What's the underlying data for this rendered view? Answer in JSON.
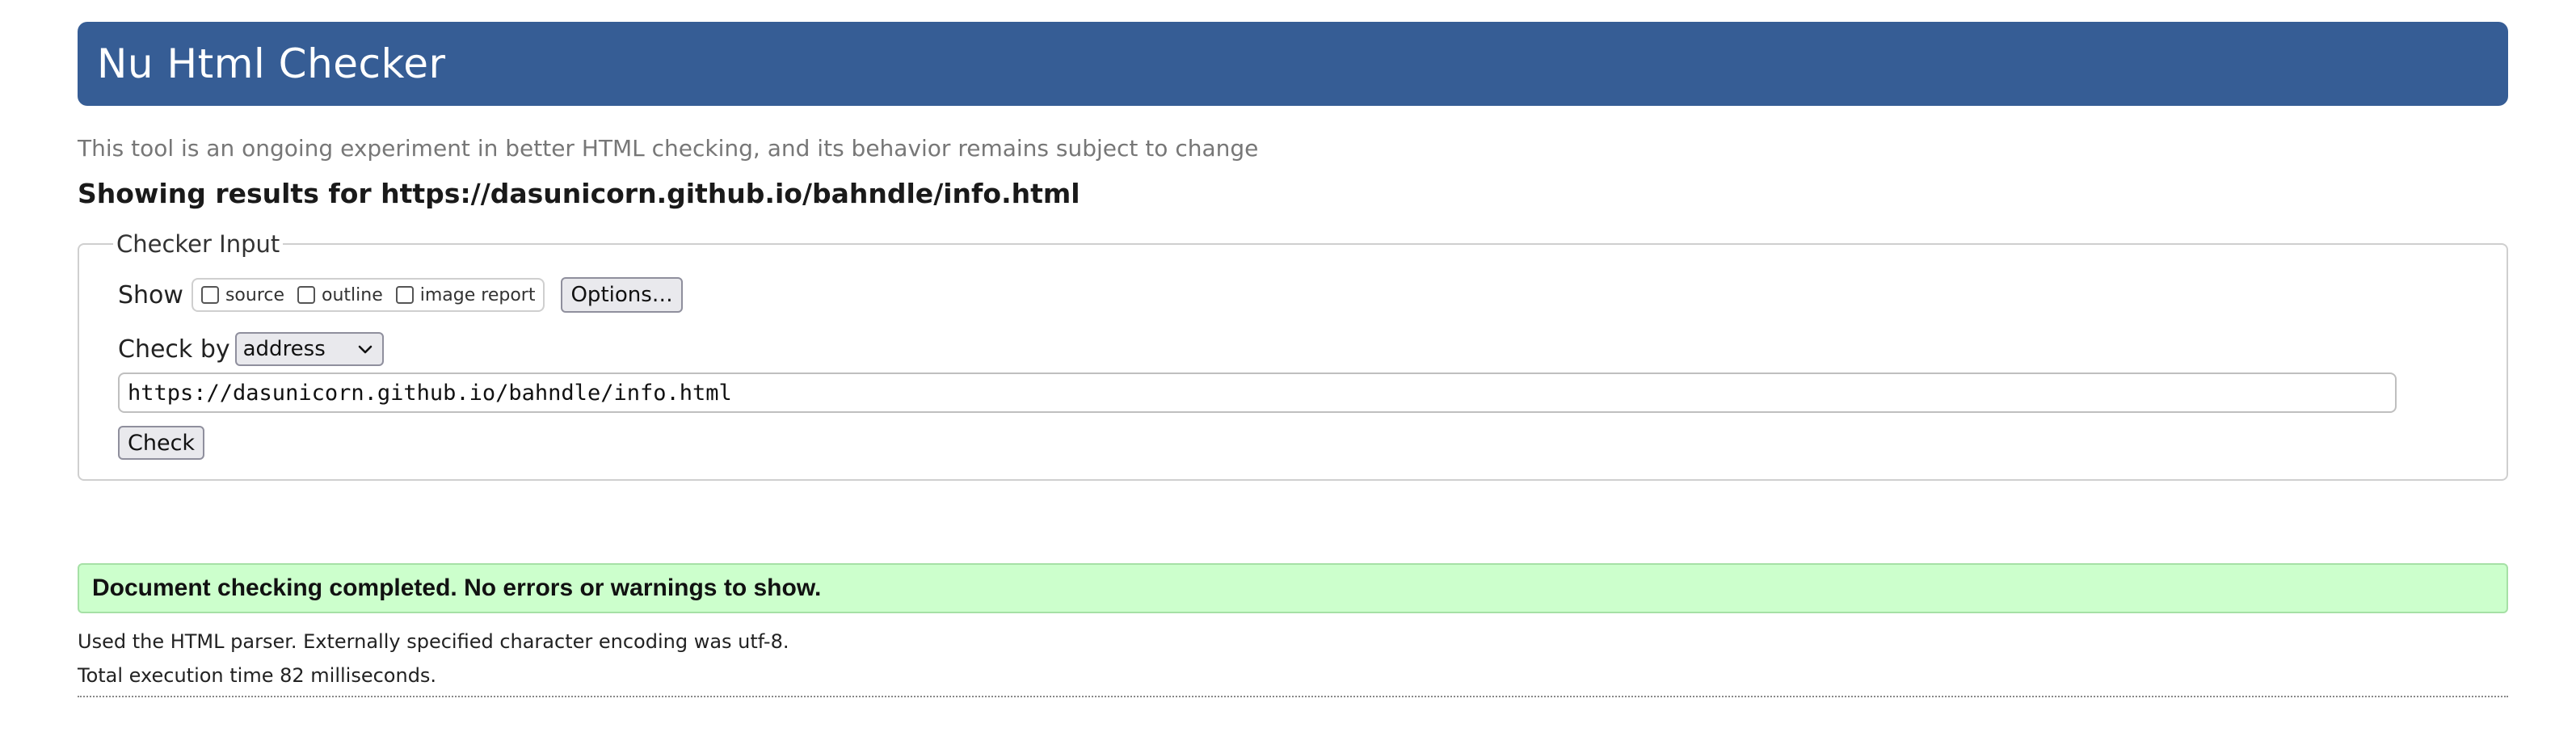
{
  "header": {
    "title": "Nu Html Checker"
  },
  "tagline": "This tool is an ongoing experiment in better HTML checking, and its behavior remains subject to change",
  "results_heading": "Showing results for https://dasunicorn.github.io/bahndle/info.html",
  "checker_input": {
    "legend": "Checker Input",
    "show_label": "Show",
    "show_options": [
      {
        "label": "source",
        "checked": false
      },
      {
        "label": "outline",
        "checked": false
      },
      {
        "label": "image report",
        "checked": false
      }
    ],
    "options_button": "Options…",
    "check_by_label": "Check by",
    "check_by_selected": "address",
    "url_value": "https://dasunicorn.github.io/bahndle/info.html",
    "check_button": "Check"
  },
  "result": {
    "success_message": "Document checking completed. No errors or warnings to show.",
    "parser_info": "Used the HTML parser. Externally specified character encoding was utf-8.",
    "execution_time": "Total execution time 82 milliseconds."
  },
  "colors": {
    "header_bg": "#365d95",
    "success_bg": "#ccffcc"
  },
  "icons": {
    "select_arrow": "chevron-down-icon",
    "checkbox": "checkbox-unchecked-icon"
  }
}
